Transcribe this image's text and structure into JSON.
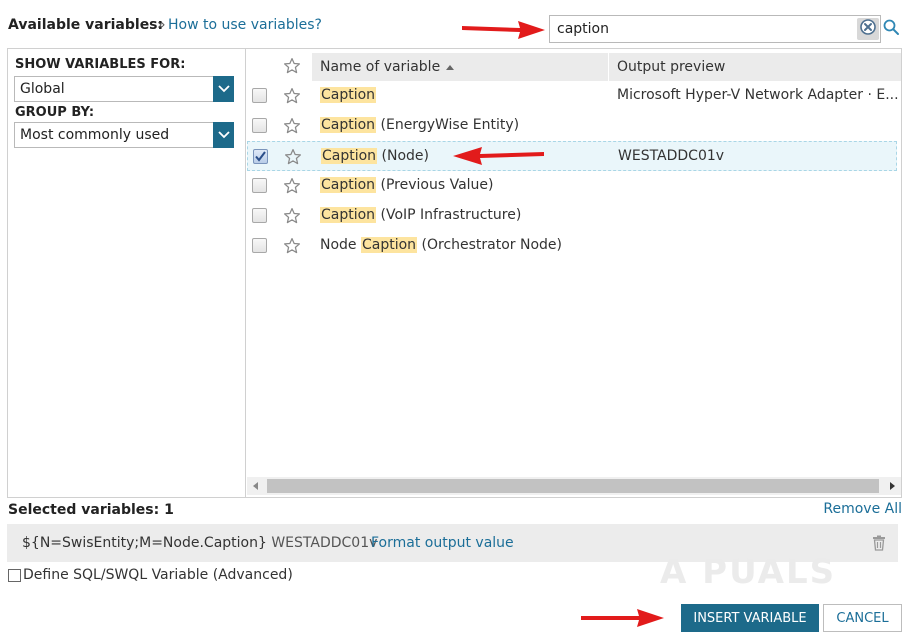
{
  "header": {
    "available_label": "Available variables:",
    "separator": "»",
    "how_to_link": "How to use variables?"
  },
  "search": {
    "value": "caption",
    "placeholder": ""
  },
  "filters": {
    "show_for_label": "SHOW VARIABLES FOR:",
    "show_for_value": "Global",
    "group_by_label": "GROUP BY:",
    "group_by_value": "Most commonly used"
  },
  "table": {
    "columns": [
      "Name of variable",
      "Output preview"
    ],
    "sort": "ascending",
    "rows": [
      {
        "pre": "",
        "hl": "Caption",
        "post": "",
        "preview": "Microsoft Hyper-V Network Adapter · E...",
        "checked": false,
        "selected": false
      },
      {
        "pre": "",
        "hl": "Caption",
        "post": " (EnergyWise Entity)",
        "preview": "",
        "checked": false,
        "selected": false
      },
      {
        "pre": "",
        "hl": "Caption",
        "post": " (Node)",
        "preview": "WESTADDC01v",
        "checked": true,
        "selected": true
      },
      {
        "pre": "",
        "hl": "Caption",
        "post": " (Previous Value)",
        "preview": "",
        "checked": false,
        "selected": false
      },
      {
        "pre": "",
        "hl": "Caption",
        "post": " (VoIP Infrastructure)",
        "preview": "",
        "checked": false,
        "selected": false
      },
      {
        "pre": "Node ",
        "hl": "Caption",
        "post": " (Orchestrator Node)",
        "preview": "",
        "checked": false,
        "selected": false
      }
    ]
  },
  "selected": {
    "label": "Selected variables: 1",
    "remove_all": "Remove All",
    "variable": "${N=SwisEntity;M=Node.Caption}",
    "variable_preview": "WESTADDC01v",
    "format_link": "Format output value"
  },
  "define": {
    "label": "Define SQL/SWQL Variable (Advanced)",
    "checked": false
  },
  "buttons": {
    "insert": "INSERT VARIABLE",
    "cancel": "CANCEL"
  },
  "watermark": "A PUALS",
  "colors": {
    "accent": "#1d6a8a",
    "link": "#1b6e98",
    "highlight": "#fde49f",
    "annotation_arrow": "#e21b1b"
  },
  "icons": {
    "search": "magnifier-icon",
    "clear": "clear-circle-icon",
    "star": "star-outline-icon",
    "trash": "trash-icon",
    "dropdown": "chevron-down-icon"
  }
}
